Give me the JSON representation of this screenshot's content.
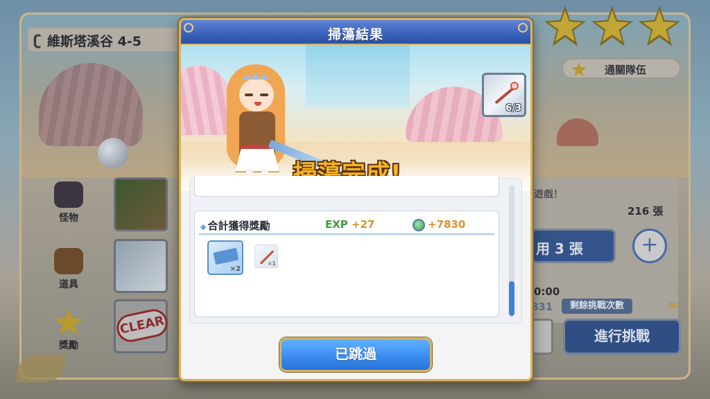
{
  "stage": {
    "title": "維斯塔溪谷 4-5",
    "stars": 3,
    "clear_team_label": "通關隊伍"
  },
  "left_menu": {
    "items": [
      {
        "label": "怪物",
        "icon": "monster-icon"
      },
      {
        "label": "道具",
        "icon": "chest-icon"
      },
      {
        "label": "獎勵",
        "icon": "star-icon"
      }
    ]
  },
  "clear_stamp": "CLEAR",
  "right_panel": {
    "text_game": "遊戲！",
    "ticket_count": "216 張",
    "use_button": "用 3 張",
    "plus_label": "+",
    "time": "0:00",
    "number": "831",
    "remaining_label": "剩餘挑戰次數",
    "remaining_value": "∞",
    "challenge_button": "進行挑戰"
  },
  "modal": {
    "title": "掃蕩結果",
    "complete_text": "掃蕩完成!",
    "item_counter": "6/3",
    "result": {
      "label": "合計獲得獎勵",
      "exp_key": "EXP",
      "exp_value": "+27",
      "mana_value": "+7830",
      "items": [
        {
          "name": "sweep-ticket",
          "qty": "×2"
        },
        {
          "name": "staff-item",
          "qty": "×1"
        }
      ]
    },
    "skip_button": "已跳過"
  },
  "colors": {
    "header_blue": "#3a62b9",
    "gold_border": "#d6b46a",
    "exp_green": "#3e9a38",
    "reward_orange": "#e0902b",
    "button_blue": "#3a8ef2"
  }
}
